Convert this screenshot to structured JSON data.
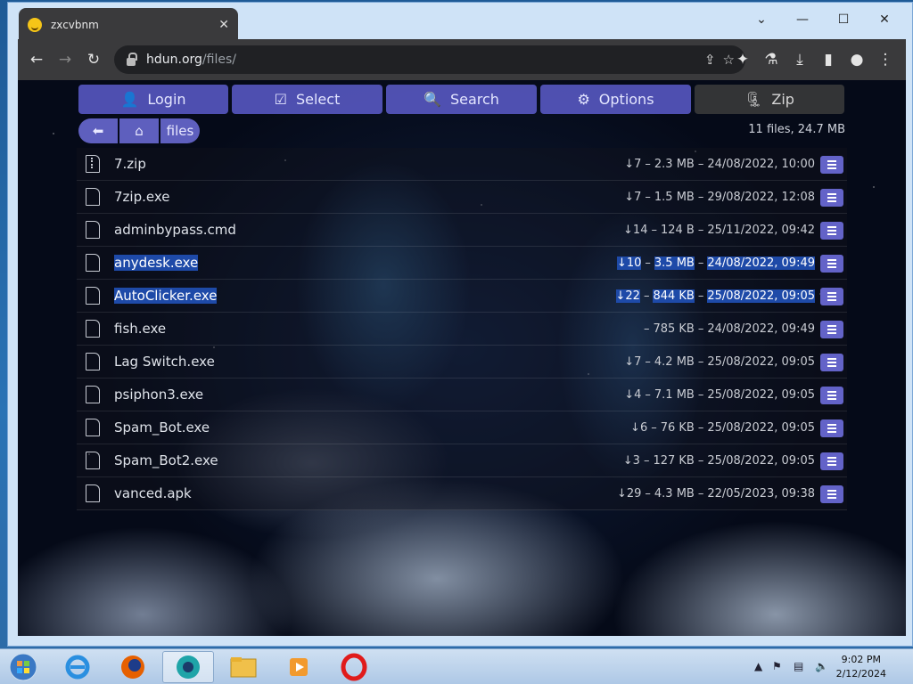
{
  "browser": {
    "tab_title": "zxcvbnm",
    "url_domain": "hdun.org",
    "url_path": "/files/"
  },
  "nav": {
    "login": "Login",
    "select": "Select",
    "search": "Search",
    "options": "Options",
    "zip": "Zip"
  },
  "breadcrumb": {
    "folder": "files"
  },
  "summary": "11 files, 24.7 MB",
  "files": [
    {
      "name": "7.zip",
      "downloads": "↓7",
      "size": "2.3 MB",
      "date": "24/08/2022, 10:00",
      "selected": false,
      "icon": "zip-file-icon"
    },
    {
      "name": "7zip.exe",
      "downloads": "↓7",
      "size": "1.5 MB",
      "date": "29/08/2022, 12:08",
      "selected": false,
      "icon": "file-icon"
    },
    {
      "name": "adminbypass.cmd",
      "downloads": "↓14",
      "size": "124 B",
      "date": "25/11/2022, 09:42",
      "selected": false,
      "icon": "file-icon"
    },
    {
      "name": "anydesk.exe",
      "downloads": "↓10",
      "size": "3.5 MB",
      "date": "24/08/2022, 09:49",
      "selected": true,
      "icon": "file-icon"
    },
    {
      "name": "AutoClicker.exe",
      "downloads": "↓22",
      "size": "844 KB",
      "date": "25/08/2022, 09:05",
      "selected": true,
      "icon": "file-icon"
    },
    {
      "name": "fish.exe",
      "downloads": "",
      "size": "785 KB",
      "date": "24/08/2022, 09:49",
      "selected": false,
      "icon": "file-icon"
    },
    {
      "name": "Lag Switch.exe",
      "downloads": "↓7",
      "size": "4.2 MB",
      "date": "25/08/2022, 09:05",
      "selected": false,
      "icon": "file-icon"
    },
    {
      "name": "psiphon3.exe",
      "downloads": "↓4",
      "size": "7.1 MB",
      "date": "25/08/2022, 09:05",
      "selected": false,
      "icon": "file-icon"
    },
    {
      "name": "Spam_Bot.exe",
      "downloads": "↓6",
      "size": "76 KB",
      "date": "25/08/2022, 09:05",
      "selected": false,
      "icon": "file-icon"
    },
    {
      "name": "Spam_Bot2.exe",
      "downloads": "↓3",
      "size": "127 KB",
      "date": "25/08/2022, 09:05",
      "selected": false,
      "icon": "file-icon"
    },
    {
      "name": "vanced.apk",
      "downloads": "↓29",
      "size": "4.3 MB",
      "date": "22/05/2023, 09:38",
      "selected": false,
      "icon": "file-icon"
    }
  ],
  "taskbar": {
    "time": "9:02 PM",
    "date": "2/12/2024"
  },
  "colors": {
    "accent": "#5f5fd2",
    "selection": "#1e4aa8",
    "browser_chrome": "#3a3a3c"
  }
}
